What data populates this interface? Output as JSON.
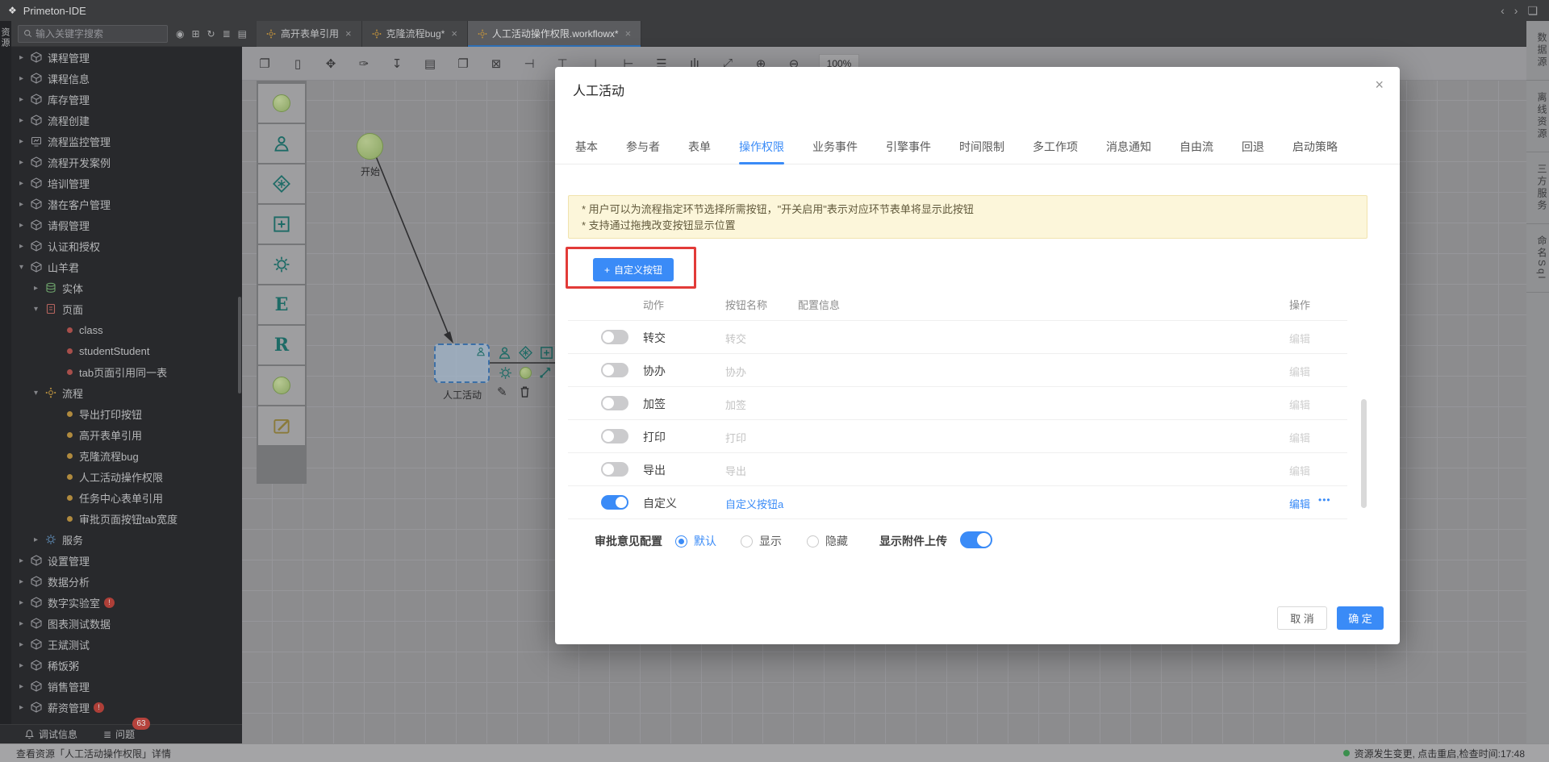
{
  "titlebar": {
    "app_title": "Primeton-IDE",
    "right_icons": [
      {
        "name": "back-icon",
        "glyph": "‹"
      },
      {
        "name": "forward-icon",
        "glyph": "›"
      },
      {
        "name": "save-icon",
        "glyph": "❏"
      }
    ]
  },
  "left_rail": {
    "label": "资源"
  },
  "search": {
    "placeholder": "输入关键字搜索",
    "icons": [
      {
        "name": "ai-icon",
        "glyph": "◉"
      },
      {
        "name": "new-box-icon",
        "glyph": "⊞"
      },
      {
        "name": "refresh-icon",
        "glyph": "↻"
      },
      {
        "name": "outline-icon",
        "glyph": "≣"
      },
      {
        "name": "book-icon",
        "glyph": "▤"
      }
    ]
  },
  "doc_tabs": [
    {
      "label": "高开表单引用",
      "active": false
    },
    {
      "label": "克隆流程bug*",
      "active": false
    },
    {
      "label": "人工活动操作权限.workflowx*",
      "active": true
    }
  ],
  "tree": {
    "items": [
      {
        "label": "课程管理",
        "level": 0,
        "icon": "cube",
        "expand": "closed"
      },
      {
        "label": "课程信息",
        "level": 0,
        "icon": "cube",
        "expand": "closed"
      },
      {
        "label": "库存管理",
        "level": 0,
        "icon": "cube",
        "expand": "closed"
      },
      {
        "label": "流程创建",
        "level": 0,
        "icon": "cube",
        "expand": "closed"
      },
      {
        "label": "流程监控管理",
        "level": 0,
        "icon": "monitor",
        "expand": "closed"
      },
      {
        "label": "流程开发案例",
        "level": 0,
        "icon": "cube",
        "expand": "closed"
      },
      {
        "label": "培训管理",
        "level": 0,
        "icon": "cube",
        "expand": "closed"
      },
      {
        "label": "潜在客户管理",
        "level": 0,
        "icon": "cube",
        "expand": "closed"
      },
      {
        "label": "请假管理",
        "level": 0,
        "icon": "cube",
        "expand": "closed"
      },
      {
        "label": "认证和授权",
        "level": 0,
        "icon": "cube",
        "expand": "closed"
      },
      {
        "label": "山羊君",
        "level": 0,
        "icon": "cube",
        "expand": "open"
      },
      {
        "label": "实体",
        "level": 1,
        "icon": "db",
        "expand": "closed"
      },
      {
        "label": "页面",
        "level": 1,
        "icon": "page",
        "expand": "open"
      },
      {
        "label": "class",
        "level": 2,
        "icon": "dot-red",
        "expand": "none"
      },
      {
        "label": "studentStudent",
        "level": 2,
        "icon": "dot-red",
        "expand": "none"
      },
      {
        "label": "tab页面引用同一表",
        "level": 2,
        "icon": "dot-red",
        "expand": "none"
      },
      {
        "label": "流程",
        "level": 1,
        "icon": "flow",
        "expand": "open"
      },
      {
        "label": "导出打印按钮",
        "level": 2,
        "icon": "dot-orange",
        "expand": "none"
      },
      {
        "label": "高开表单引用",
        "level": 2,
        "icon": "dot-orange",
        "expand": "none"
      },
      {
        "label": "克隆流程bug",
        "level": 2,
        "icon": "dot-orange",
        "expand": "none"
      },
      {
        "label": "人工活动操作权限",
        "level": 2,
        "icon": "dot-orange",
        "expand": "none"
      },
      {
        "label": "任务中心表单引用",
        "level": 2,
        "icon": "dot-orange",
        "expand": "none"
      },
      {
        "label": "审批页面按钮tab宽度",
        "level": 2,
        "icon": "dot-orange",
        "expand": "none"
      },
      {
        "label": "服务",
        "level": 1,
        "icon": "gear",
        "expand": "closed"
      },
      {
        "label": "设置管理",
        "level": 0,
        "icon": "cube",
        "expand": "closed"
      },
      {
        "label": "数据分析",
        "level": 0,
        "icon": "cube",
        "expand": "closed"
      },
      {
        "label": "数字实验室",
        "level": 0,
        "icon": "cube",
        "expand": "closed",
        "badge": "!"
      },
      {
        "label": "图表测试数据",
        "level": 0,
        "icon": "cube",
        "expand": "closed"
      },
      {
        "label": "王斌测试",
        "level": 0,
        "icon": "cube",
        "expand": "closed"
      },
      {
        "label": "稀饭粥",
        "level": 0,
        "icon": "cube",
        "expand": "closed"
      },
      {
        "label": "销售管理",
        "level": 0,
        "icon": "cube",
        "expand": "closed"
      },
      {
        "label": "薪资管理",
        "level": 0,
        "icon": "cube",
        "expand": "closed",
        "badge": "!"
      }
    ]
  },
  "bottom_panel": {
    "debug_label": "调试信息",
    "problems_label": "问题",
    "problems_count": "63"
  },
  "statusbar": {
    "left": "查看资源「人工活动操作权限」详情",
    "right": "资源发生变更, 点击重启,检查时间:17:48"
  },
  "canvas": {
    "zoom_level": "100%",
    "start_label": "开始",
    "activity_label": "人工活动",
    "toolbar_icons": [
      {
        "name": "copy-icon",
        "glyph": "❐"
      },
      {
        "name": "eraser-icon",
        "glyph": "▯"
      },
      {
        "name": "hand-icon",
        "glyph": "✥"
      },
      {
        "name": "brush-icon",
        "glyph": "✑"
      },
      {
        "name": "download-icon",
        "glyph": "↧"
      },
      {
        "name": "document-icon",
        "glyph": "▤"
      },
      {
        "name": "duplicate-icon",
        "glyph": "❐"
      },
      {
        "name": "delete-icon",
        "glyph": "⊠"
      },
      {
        "name": "align-left-icon",
        "glyph": "⊣"
      },
      {
        "name": "align-top-icon",
        "glyph": "⊤"
      },
      {
        "name": "align-bottom-icon",
        "glyph": "⊥"
      },
      {
        "name": "align-right-icon",
        "glyph": "⊢"
      },
      {
        "name": "distribute-icon",
        "glyph": "☰"
      },
      {
        "name": "stats-icon",
        "glyph": "ılı"
      },
      {
        "name": "fit-screen-icon",
        "glyph": "⤢"
      },
      {
        "name": "zoom-in-icon",
        "glyph": "⊕"
      },
      {
        "name": "zoom-out-icon",
        "glyph": "⊖"
      }
    ]
  },
  "right_rail": {
    "tabs": [
      "数据源",
      "离线资源",
      "三方服务",
      "命名Sql"
    ]
  },
  "modal": {
    "title": "人工活动",
    "close_glyph": "×",
    "tabs": [
      "基本",
      "参与者",
      "表单",
      "操作权限",
      "业务事件",
      "引擎事件",
      "时间限制",
      "多工作项",
      "消息通知",
      "自由流",
      "回退",
      "启动策略"
    ],
    "active_tab": "操作权限",
    "notice_line1": "* 用户可以为流程指定环节选择所需按钮，\"开关启用\"表示对应环节表单将显示此按钮",
    "notice_line2": "* 支持通过拖拽改变按钮显示位置",
    "add_button_plus": "+",
    "add_button_label": "自定义按钮",
    "table": {
      "headers": [
        "动作",
        "按钮名称",
        "配置信息",
        "操作"
      ],
      "rows": [
        {
          "action": "转交",
          "name": "转交",
          "enabled": false,
          "op": "编辑"
        },
        {
          "action": "协办",
          "name": "协办",
          "enabled": false,
          "op": "编辑"
        },
        {
          "action": "加签",
          "name": "加签",
          "enabled": false,
          "op": "编辑"
        },
        {
          "action": "打印",
          "name": "打印",
          "enabled": false,
          "op": "编辑"
        },
        {
          "action": "导出",
          "name": "导出",
          "enabled": false,
          "op": "编辑"
        },
        {
          "action": "自定义",
          "name": "自定义按钮a",
          "enabled": true,
          "op": "编辑",
          "more": "•••"
        }
      ]
    },
    "opinion": {
      "label": "审批意见配置",
      "options": [
        "默认",
        "显示",
        "隐藏"
      ],
      "selected": "默认"
    },
    "attachment": {
      "label": "显示附件上传",
      "enabled": true
    },
    "footer": {
      "cancel": "取 消",
      "ok": "确 定"
    }
  },
  "colors": {
    "accent_blue": "#3a8bf7",
    "annotation_red": "#e23b38",
    "notice_bg": "#fcf6da",
    "status_green": "#3c8f4e"
  }
}
